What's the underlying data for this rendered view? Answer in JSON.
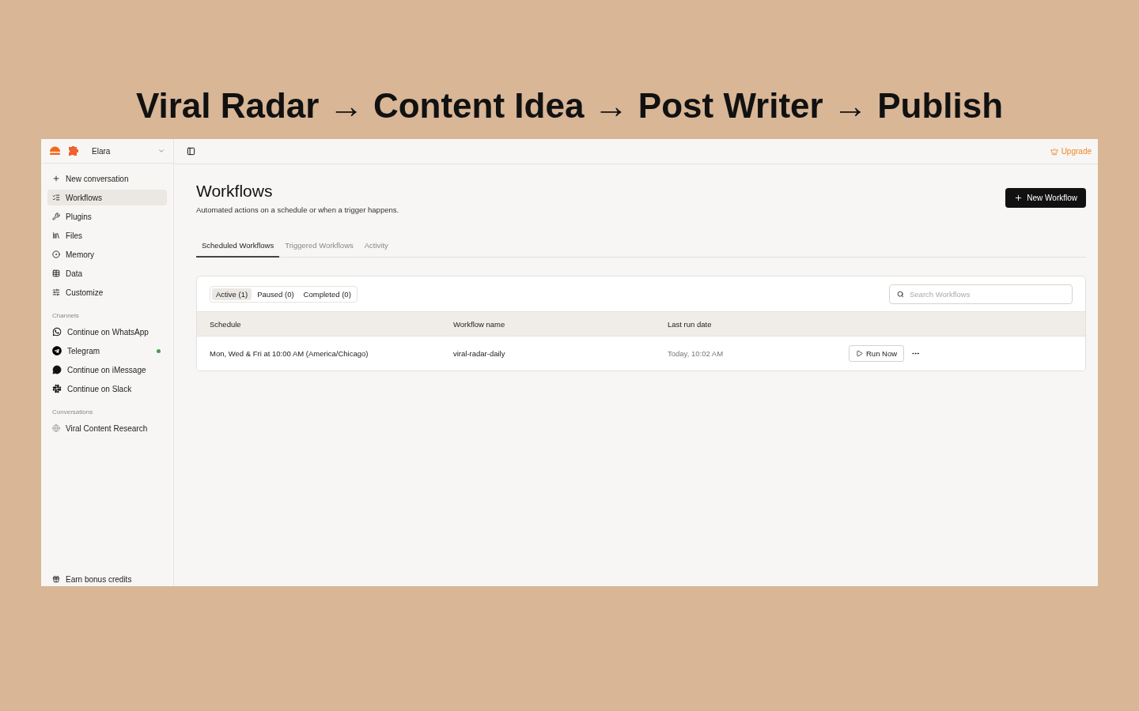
{
  "headline": "Viral Radar → Content Idea → Post Writer → Publish",
  "sidebar": {
    "workspace": "Elara",
    "nav": [
      {
        "label": "New conversation",
        "selected": false
      },
      {
        "label": "Workflows",
        "selected": true
      },
      {
        "label": "Plugins",
        "selected": false
      },
      {
        "label": "Files",
        "selected": false
      },
      {
        "label": "Memory",
        "selected": false
      },
      {
        "label": "Data",
        "selected": false
      },
      {
        "label": "Customize",
        "selected": false
      }
    ],
    "channels_title": "Channels",
    "channels": [
      {
        "label": "Continue on WhatsApp",
        "connected": false
      },
      {
        "label": "Telegram",
        "connected": true
      },
      {
        "label": "Continue on iMessage",
        "connected": false
      },
      {
        "label": "Continue on Slack",
        "connected": false
      }
    ],
    "conversations_title": "Conversations",
    "conversations": [
      {
        "label": "Viral Content Research",
        "selected": false
      }
    ],
    "footer": "Earn bonus credits"
  },
  "topbar": {
    "upgrade": "Upgrade"
  },
  "page": {
    "title": "Workflows",
    "subtitle": "Automated actions on a schedule or when a trigger happens.",
    "new_button": "New Workflow",
    "tabs": [
      {
        "label": "Scheduled Workflows",
        "selected": true
      },
      {
        "label": "Triggered Workflows",
        "selected": false
      },
      {
        "label": "Activity",
        "selected": false
      }
    ],
    "filters": [
      {
        "label": "Active (1)",
        "selected": true
      },
      {
        "label": "Paused (0)",
        "selected": false
      },
      {
        "label": "Completed (0)",
        "selected": false
      }
    ],
    "search": {
      "placeholder": "Search Workflows"
    },
    "table": {
      "columns": [
        "Schedule",
        "Workflow name",
        "Last run date"
      ],
      "rows": [
        {
          "schedule": "Mon, Wed & Fri at 10:00 AM (America/Chicago)",
          "workflow_name": "viral-radar-daily",
          "last_run": "Today, 10:02 AM",
          "action": "Run Now"
        }
      ]
    }
  }
}
